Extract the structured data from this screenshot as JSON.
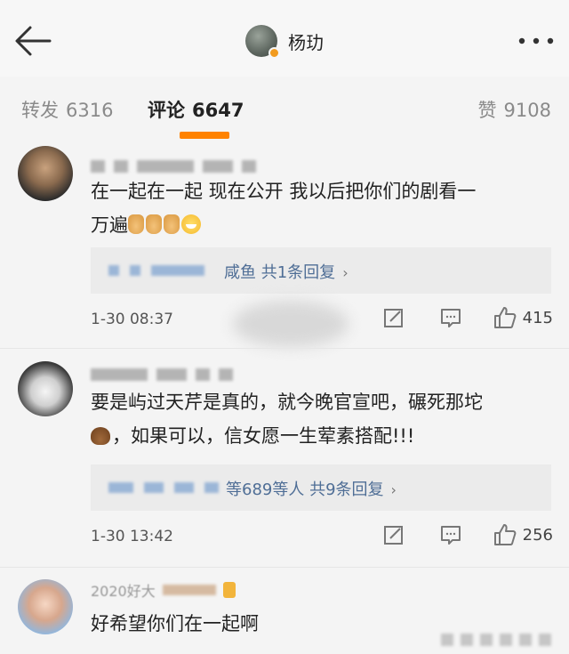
{
  "header": {
    "name": "杨玏",
    "back_icon": "back-arrow-icon",
    "more_icon": "more-dots-icon",
    "verified_color": "#f29b1f"
  },
  "tabs": [
    {
      "label": "转发",
      "count": "6316"
    },
    {
      "label": "评论",
      "count": "6647"
    },
    {
      "label": "赞",
      "count": "9108"
    }
  ],
  "accent_color": "#ff8200",
  "comments": [
    {
      "text_line1": "在一起在一起 现在公开 我以后把你们的剧看一",
      "text_line2": "万遍",
      "reply_label": "咸鱼 共1条回复",
      "time": "1-30 08:37",
      "likes": "415"
    },
    {
      "text_line1": "要是屿过天芹是真的，就今晚官宣吧，碾死那坨",
      "text_line2": "，如果可以，信女愿一生荤素搭配!!!",
      "reply_label": "等689等人 共9条回复",
      "time": "1-30 13:42",
      "likes": "256"
    },
    {
      "name_partial": "2020好大",
      "text_line1": "好希望你们在一起啊"
    }
  ],
  "chevron_right": "›"
}
